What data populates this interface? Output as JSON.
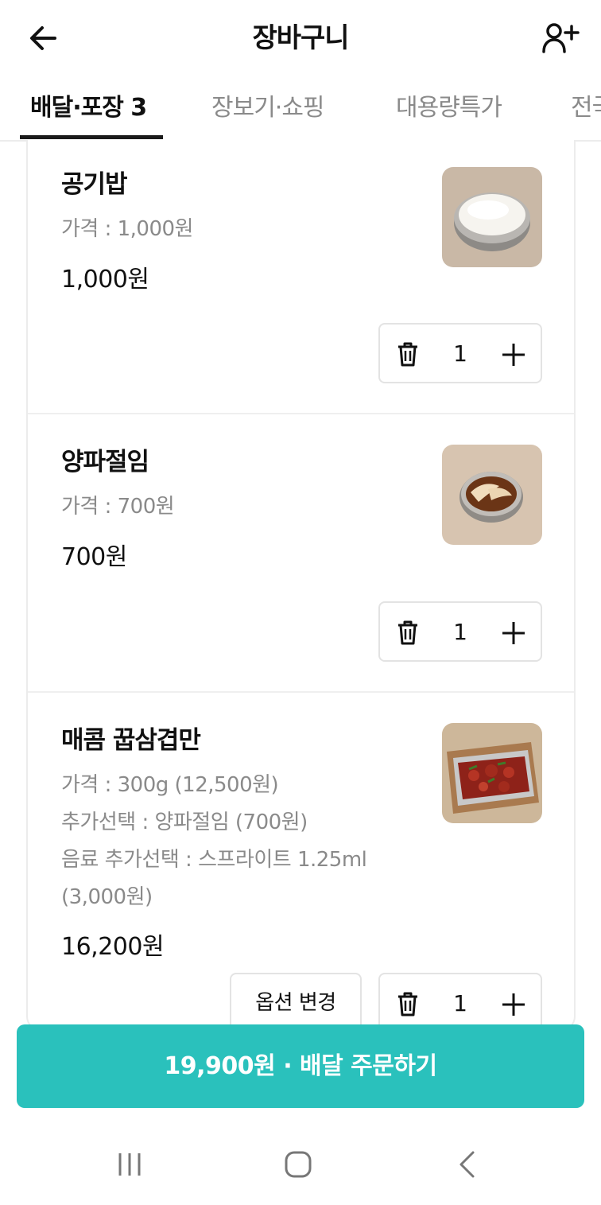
{
  "header": {
    "title": "장바구니",
    "back_icon": "arrow-left-icon",
    "invite_icon": "person-add-icon"
  },
  "tabs": [
    {
      "label": "배달·포장 3",
      "active": true
    },
    {
      "label": "장보기·쇼핑",
      "active": false
    },
    {
      "label": "대용량특가",
      "active": false
    },
    {
      "label": "전국",
      "active": false
    }
  ],
  "items": [
    {
      "name": "공기밥",
      "options": [
        "가격 : 1,000원"
      ],
      "price": "1,000원",
      "quantity": "1",
      "image": "rice-bowl-photo"
    },
    {
      "name": "양파절임",
      "options": [
        "가격 : 700원"
      ],
      "price": "700원",
      "quantity": "1",
      "image": "pickled-onion-photo"
    },
    {
      "name": "매콤 꿉삼겹만",
      "options": [
        "가격 : 300g (12,500원)",
        "추가선택 : 양파절임 (700원)",
        "음료 추가선택 : 스프라이트 1.25ml",
        "(3,000원)"
      ],
      "price": "16,200원",
      "quantity": "1",
      "option_change_label": "옵션 변경",
      "image": "spicy-pork-box-photo"
    }
  ],
  "order_button": {
    "label": "19,900원 · 배달 주문하기"
  },
  "colors": {
    "accent": "#2ac1bc",
    "muted_text": "#8a8a8a",
    "border": "#e3e3e3"
  },
  "navbar": {
    "recent_icon": "recent-apps-icon",
    "home_icon": "home-icon",
    "back_icon": "system-back-icon"
  }
}
